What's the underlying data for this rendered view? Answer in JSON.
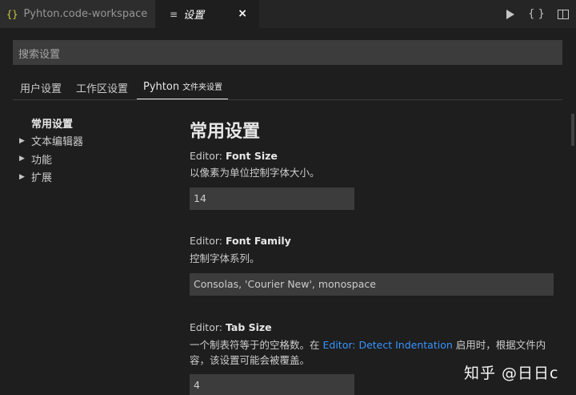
{
  "tabs": [
    {
      "icon": "{}",
      "label": "Pyhton.code-workspace"
    },
    {
      "icon": "≡",
      "label": "设置",
      "close": "×"
    }
  ],
  "actions": {
    "run": "",
    "braces": "{ }",
    "split": ""
  },
  "search": {
    "placeholder": "搜索设置"
  },
  "scopes": {
    "user": "用户设置",
    "workspace": "工作区设置",
    "folder_name": "Pyhton",
    "folder_suffix": "文件夹设置"
  },
  "toc": {
    "items": [
      "常用设置",
      "文本编辑器",
      "功能",
      "扩展"
    ],
    "chevron": "▶"
  },
  "section_title": "常用设置",
  "settings": [
    {
      "category": "Editor: ",
      "name": "Font Size",
      "desc": "以像素为单位控制字体大小。",
      "value": "14"
    },
    {
      "category": "Editor: ",
      "name": "Font Family",
      "desc": "控制字体系列。",
      "value": "Consolas, 'Courier New', monospace"
    },
    {
      "category": "Editor: ",
      "name": "Tab Size",
      "desc_before": "一个制表符等于的空格数。在 ",
      "desc_link": "Editor: Detect Indentation",
      "desc_after": " 启用时，根据文件内",
      "desc_line2": "容，该设置可能会被覆盖。",
      "value": "4"
    }
  ],
  "watermark": "知乎 @日日c"
}
